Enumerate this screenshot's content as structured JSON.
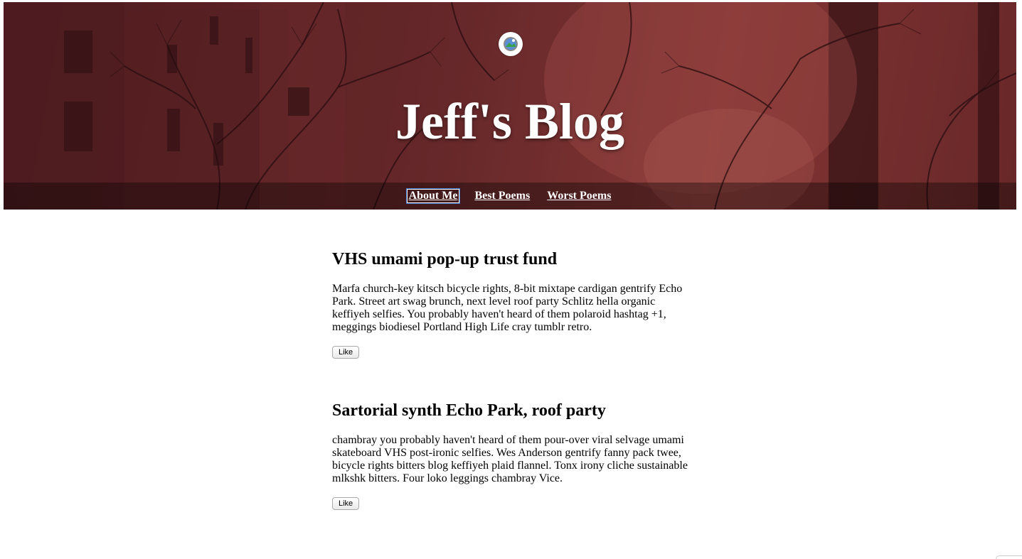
{
  "header": {
    "avatar_icon": "broken-image-icon",
    "title": "Jeff's Blog",
    "nav": [
      {
        "label": "About Me"
      },
      {
        "label": "Best Poems"
      },
      {
        "label": "Worst Poems"
      }
    ]
  },
  "posts": [
    {
      "title": "VHS umami pop-up trust fund",
      "body": "Marfa church-key kitsch bicycle rights, 8-bit mixtape cardigan gentrify Echo Park. Street art swag brunch, next level roof party Schlitz hella organic keffiyeh selfies. You probably haven't heard of them polaroid hashtag +1, meggings biodiesel Portland High Life cray tumblr retro.",
      "like_label": "Like"
    },
    {
      "title": "Sartorial synth Echo Park, roof party",
      "body": "chambray you probably haven't heard of them pour-over viral selvage umami skateboard VHS post-ironic selfies. Wes Anderson gentrify fanny pack twee, bicycle rights bitters blog keffiyeh plaid flannel. Tonx irony cliche sustainable mlkshk bitters. Four loko leggings chambray Vice.",
      "like_label": "Like"
    }
  ],
  "colors": {
    "header_tint": "#6a2b2c",
    "nav_focus": "#3b73c4"
  }
}
